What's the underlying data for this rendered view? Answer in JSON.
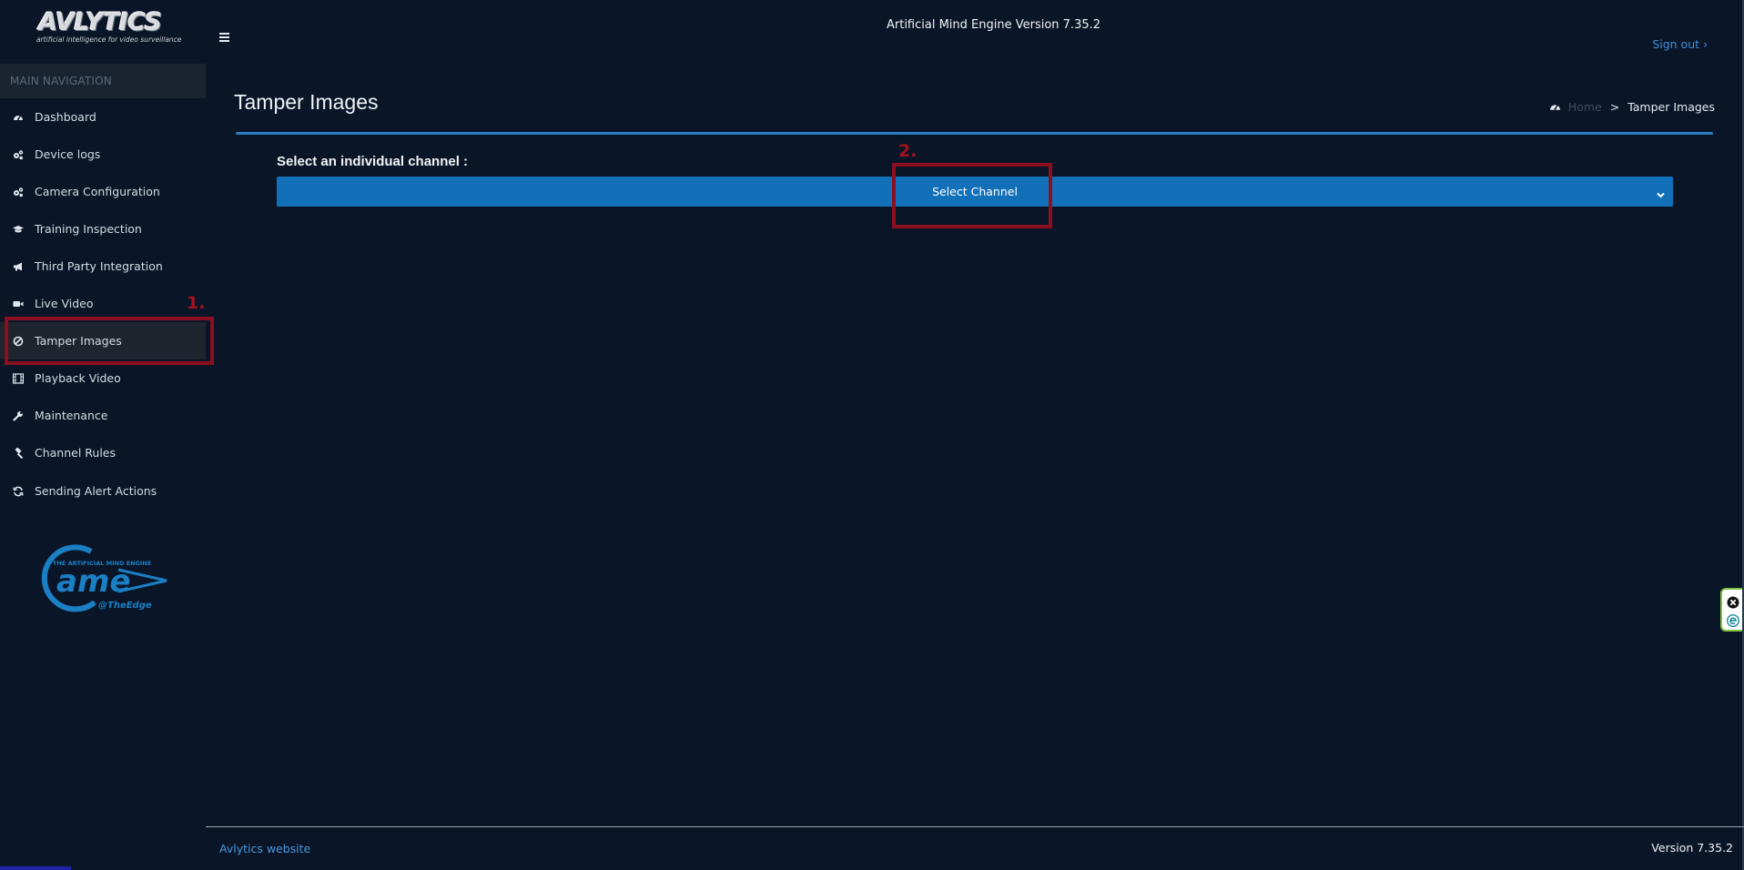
{
  "brand": {
    "logo_word": "AVLYTICS",
    "logo_tagline": "artificial intelligence for video surveillance",
    "ame_logo_top_text": "THE ARTIFICIAL MIND ENGINE",
    "ame_logo_main": "ame",
    "ame_logo_sub": "@TheEdge"
  },
  "topbar": {
    "app_version_title": "Artificial Mind Engine Version 7.35.2",
    "signout_label": "Sign out ›"
  },
  "sidebar": {
    "header": "MAIN NAVIGATION",
    "items": [
      {
        "label": "Dashboard",
        "icon": "dashboard-icon"
      },
      {
        "label": "Device logs",
        "icon": "gears-icon"
      },
      {
        "label": "Camera Configuration",
        "icon": "gears-icon"
      },
      {
        "label": "Training Inspection",
        "icon": "graduation-cap-icon"
      },
      {
        "label": "Third Party Integration",
        "icon": "bullhorn-icon"
      },
      {
        "label": "Live Video",
        "icon": "video-camera-icon"
      },
      {
        "label": "Tamper Images",
        "icon": "ban-icon",
        "active": true
      },
      {
        "label": "Playback Video",
        "icon": "film-icon"
      },
      {
        "label": "Maintenance",
        "icon": "wrench-icon"
      },
      {
        "label": "Channel Rules",
        "icon": "gavel-icon"
      },
      {
        "label": "Sending Alert Actions",
        "icon": "refresh-icon"
      }
    ]
  },
  "content": {
    "page_title": "Tamper Images",
    "breadcrumb": {
      "home": "Home",
      "separator": ">",
      "current": "Tamper Images"
    },
    "select_label": "Select an individual channel :",
    "select_value": "Select Channel"
  },
  "annotations": {
    "step1": "1.",
    "step2": "2."
  },
  "footer": {
    "website_link": "Avlytics website",
    "version": "Version 7.35.2"
  },
  "colors": {
    "background": "#0a1628",
    "accent_blue": "#1270b8",
    "annotation_red": "#8b0f1f",
    "link_blue": "#3f8fd8"
  }
}
